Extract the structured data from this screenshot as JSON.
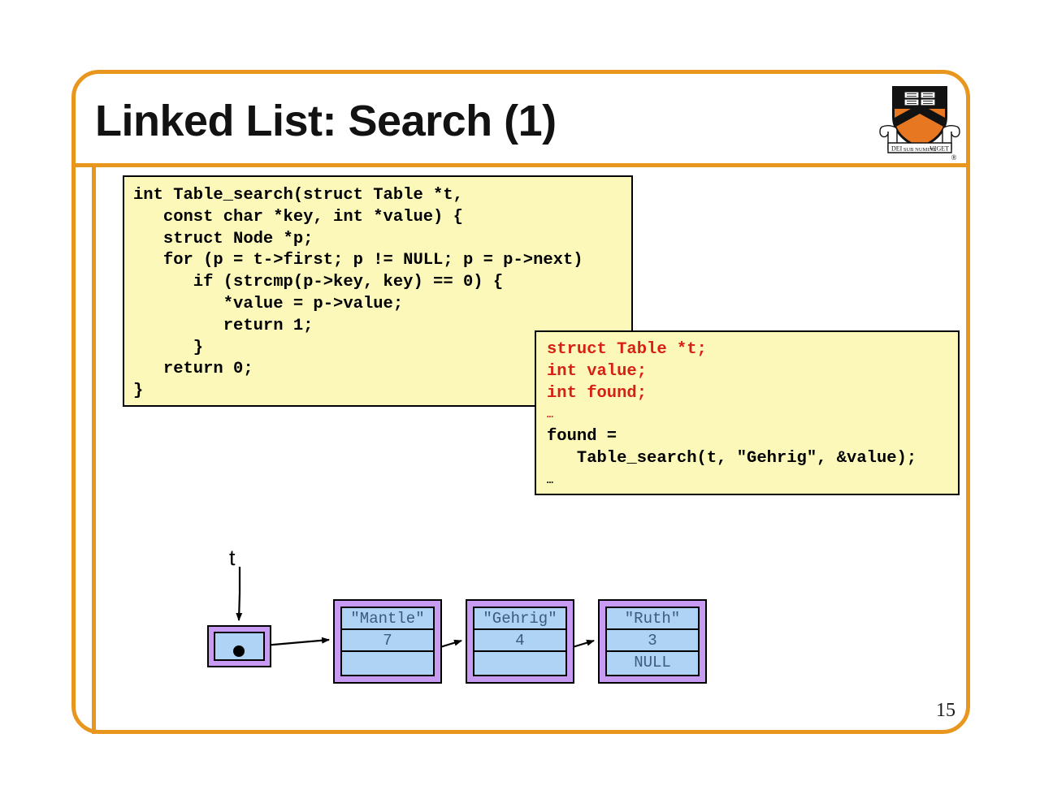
{
  "slide": {
    "title": "Linked List: Search (1)",
    "page_number": "15",
    "accent_color": "#e8961e",
    "code_bg_color": "#fbf8ba",
    "code_red_color": "#d81f14",
    "node_border_color": "#c89bf2",
    "node_cell_color": "#aed3f5"
  },
  "logo": {
    "name": "princeton-shield-logo",
    "motto_left": "DEI",
    "motto_center": "SUB NUMINE",
    "motto_right": "VIGET",
    "trademark": "®",
    "shield_orange": "#e87722",
    "shield_black": "#121212"
  },
  "code_main": {
    "name": "table-search-function",
    "lines": [
      "int Table_search(struct Table *t,",
      "   const char *key, int *value) {",
      "   struct Node *p;",
      "   for (p = t->first; p != NULL; p = p->next)",
      "      if (strcmp(p->key, key) == 0) {",
      "         *value = p->value;",
      "         return 1;",
      "      }",
      "   return 0;",
      "}"
    ]
  },
  "code_client": {
    "name": "client-usage-snippet",
    "lines": [
      {
        "text": "struct Table *t;",
        "color": "red",
        "style": "code"
      },
      {
        "text": "int value;",
        "color": "red",
        "style": "code"
      },
      {
        "text": "int found;",
        "color": "red",
        "style": "code"
      },
      {
        "text": "…",
        "color": "red",
        "style": "ellipsis"
      },
      {
        "text": "found =",
        "color": "black",
        "style": "code"
      },
      {
        "text": "   Table_search(t, \"Gehrig\", &value);",
        "color": "black",
        "style": "code"
      },
      {
        "text": "…",
        "color": "black",
        "style": "ellipsis"
      }
    ]
  },
  "diagram": {
    "name": "linked-list-diagram",
    "pointer_label": "t",
    "head_box_label": "table-head-pointer",
    "nodes": [
      {
        "key": "\"Mantle\"",
        "value": "7",
        "next": ""
      },
      {
        "key": "\"Gehrig\"",
        "value": "4",
        "next": ""
      },
      {
        "key": "\"Ruth\"",
        "value": "3",
        "next": "NULL"
      }
    ]
  }
}
